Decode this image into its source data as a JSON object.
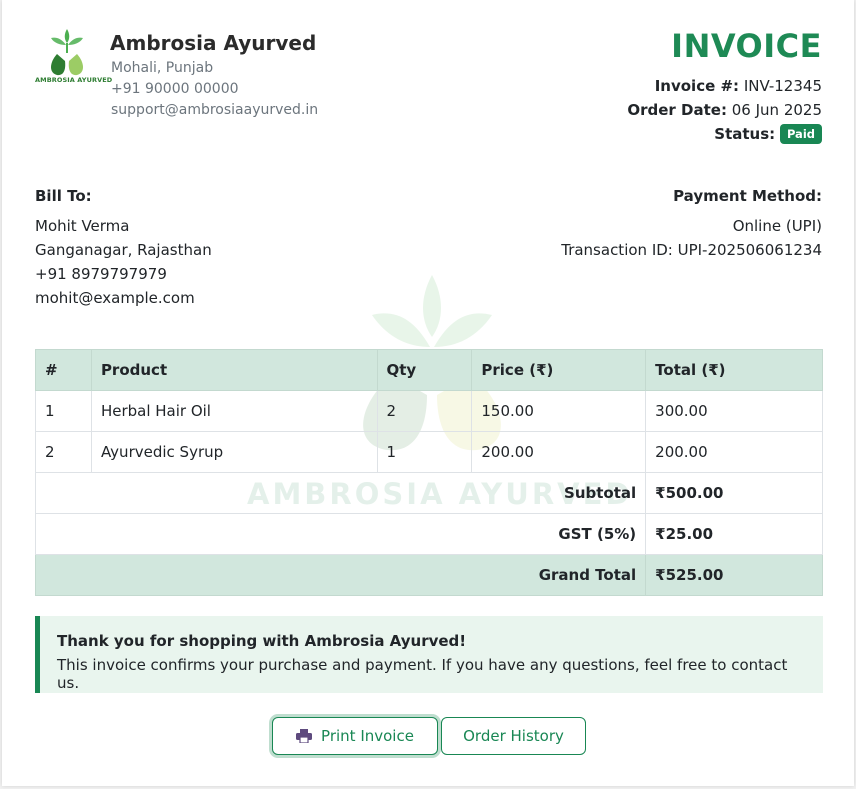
{
  "company": {
    "name": "Ambrosia Ayurved",
    "logo_text": "AMBROSIA AYURVED",
    "location": "Mohali, Punjab",
    "phone": "+91 90000 00000",
    "email": "support@ambrosiaayurved.in"
  },
  "watermark_text": "AMBROSIA AYURVED",
  "invoice": {
    "title": "INVOICE",
    "number_label": "Invoice #:",
    "number": "INV-12345",
    "date_label": "Order Date:",
    "date": "06 Jun 2025",
    "status_label": "Status:",
    "status": "Paid"
  },
  "bill_to": {
    "label": "Bill To:",
    "name": "Mohit Verma",
    "address": "Ganganagar, Rajasthan",
    "phone": "+91 8979797979",
    "email": "mohit@example.com"
  },
  "payment": {
    "label": "Payment Method:",
    "method": "Online (UPI)",
    "transaction": "Transaction ID: UPI-202506061234"
  },
  "table": {
    "headers": [
      "#",
      "Product",
      "Qty",
      "Price (₹)",
      "Total (₹)"
    ],
    "rows": [
      [
        "1",
        "Herbal Hair Oil",
        "2",
        "150.00",
        "300.00"
      ],
      [
        "2",
        "Ayurvedic Syrup",
        "1",
        "200.00",
        "200.00"
      ]
    ],
    "subtotal_label": "Subtotal",
    "subtotal": "₹500.00",
    "gst_label": "GST (5%)",
    "gst": "₹25.00",
    "grand_total_label": "Grand Total",
    "grand_total": "₹525.00"
  },
  "thanks": {
    "title": "Thank you for shopping with Ambrosia Ayurved!",
    "body": "This invoice confirms your purchase and payment. If you have any questions, feel free to contact us."
  },
  "buttons": {
    "print_label": "Print Invoice",
    "print_icon": "printer-icon",
    "history_label": "Order History"
  },
  "colors": {
    "brand_green": "#1e8a55",
    "badge_green": "#198754",
    "table_header_bg": "#d1e7dd",
    "thanks_bg": "#e9f5ee"
  }
}
